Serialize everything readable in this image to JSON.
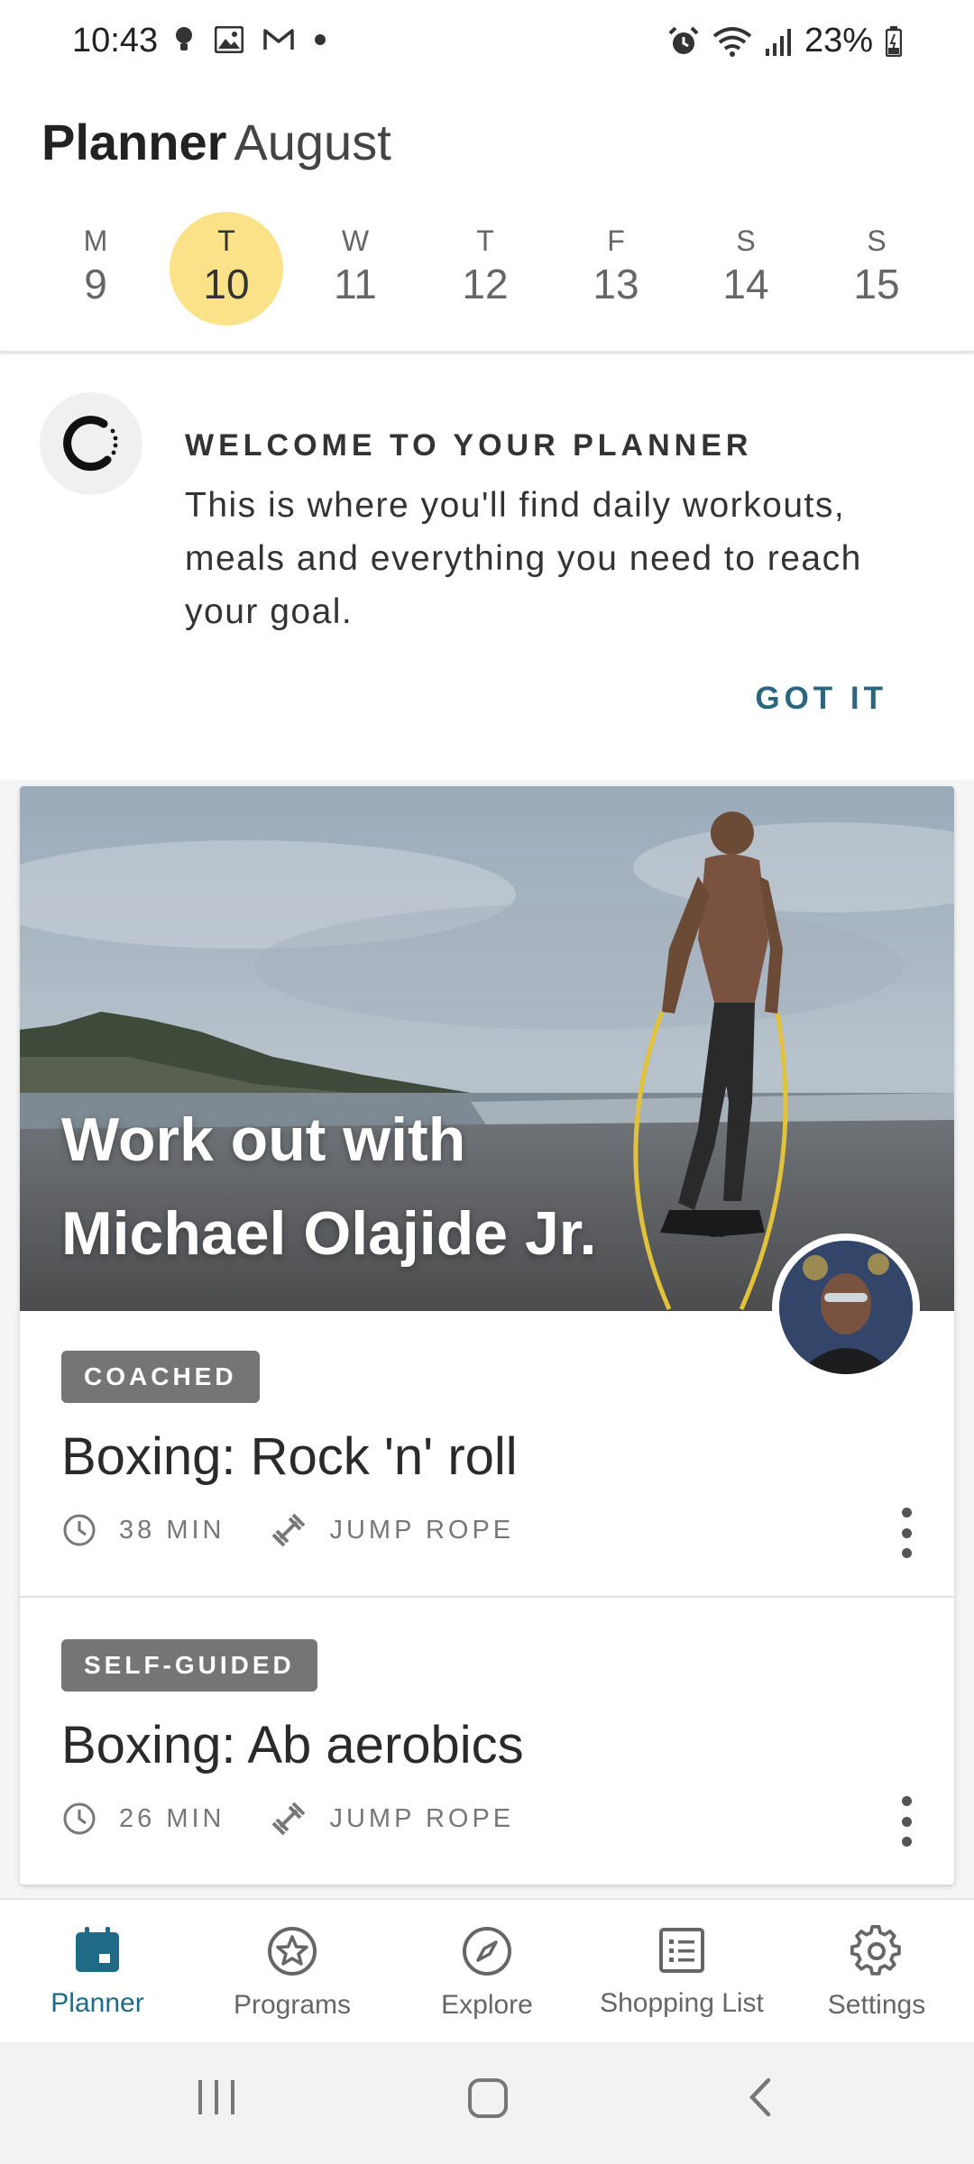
{
  "status_bar": {
    "time": "10:43",
    "battery": "23%",
    "left_icons": [
      "bulb-notification-icon",
      "gallery-notification-icon",
      "gmail-notification-icon",
      "dot-icon"
    ],
    "right_icons": [
      "alarm-icon",
      "wifi-icon",
      "signal-icon",
      "battery-icon"
    ]
  },
  "header": {
    "title": "Planner",
    "month": "August",
    "days": [
      {
        "letter": "M",
        "num": "9"
      },
      {
        "letter": "T",
        "num": "10",
        "selected": true
      },
      {
        "letter": "W",
        "num": "11"
      },
      {
        "letter": "T",
        "num": "12"
      },
      {
        "letter": "F",
        "num": "13"
      },
      {
        "letter": "S",
        "num": "14"
      },
      {
        "letter": "S",
        "num": "15"
      }
    ]
  },
  "welcome": {
    "heading": "WELCOME TO YOUR PLANNER",
    "body": "This is where you'll find daily workouts, meals and everything you need to reach your goal.",
    "button": "GOT IT"
  },
  "card": {
    "hero_title": "Work out with Michael Olajide Jr.",
    "workouts": [
      {
        "badge": "COACHED",
        "title": "Boxing: Rock 'n' roll",
        "duration": "38 MIN",
        "equipment": "JUMP ROPE"
      },
      {
        "badge": "SELF-GUIDED",
        "title": "Boxing: Ab aerobics",
        "duration": "26 MIN",
        "equipment": "JUMP ROPE"
      }
    ]
  },
  "bottom_nav": [
    {
      "label": "Planner",
      "icon": "calendar-icon",
      "active": true
    },
    {
      "label": "Programs",
      "icon": "star-badge-icon"
    },
    {
      "label": "Explore",
      "icon": "compass-icon"
    },
    {
      "label": "Shopping List",
      "icon": "list-icon"
    },
    {
      "label": "Settings",
      "icon": "gear-icon"
    }
  ],
  "colors": {
    "accent": "#1f6b87",
    "selected_day": "#fbe187",
    "badge": "#757575"
  }
}
